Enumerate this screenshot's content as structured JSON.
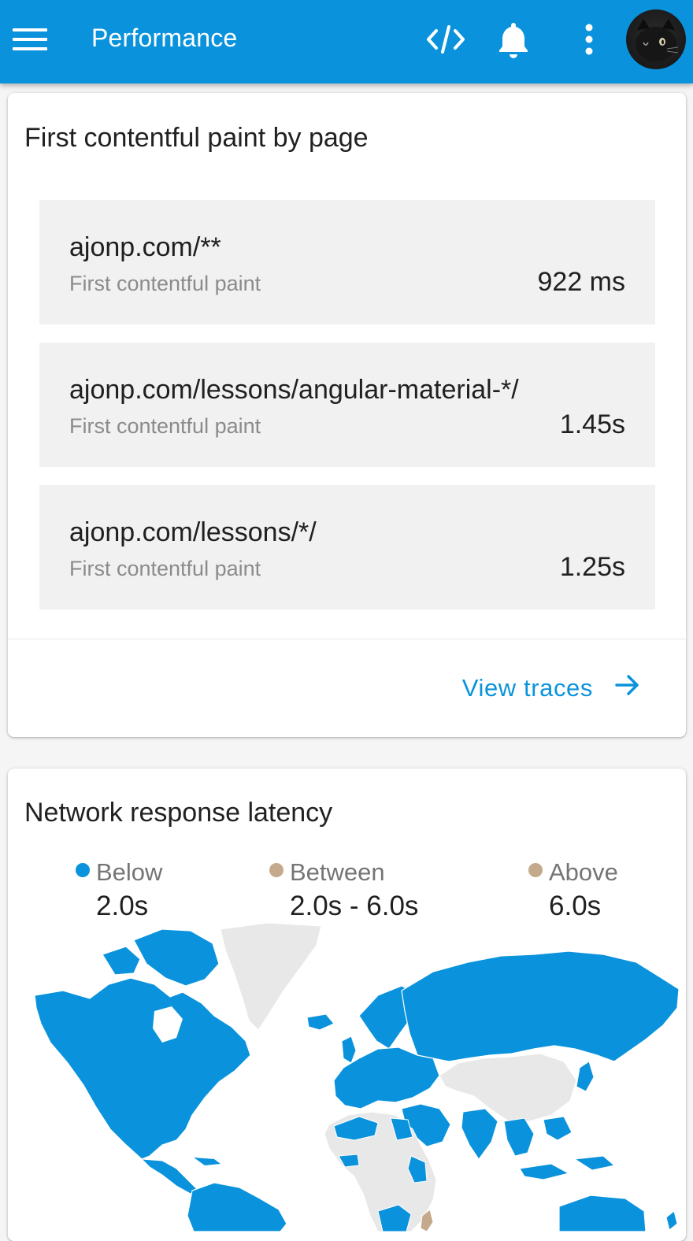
{
  "app_bar": {
    "title": "Performance",
    "icons": [
      "menu-icon",
      "code-icon",
      "bell-icon",
      "more-vert-icon",
      "avatar"
    ],
    "background": "#0a93dc"
  },
  "fcp_card": {
    "title": "First contentful paint by page",
    "rows": [
      {
        "url": "ajonp.com/**",
        "label": "First contentful paint",
        "value": "922 ms"
      },
      {
        "url": "ajonp.com/lessons/angular-material-*/",
        "label": "First contentful paint",
        "value": "1.45s"
      },
      {
        "url": "ajonp.com/lessons/*/",
        "label": "First contentful paint",
        "value": "1.25s"
      }
    ],
    "action_label": "View traces"
  },
  "latency_card": {
    "title": "Network response latency",
    "legend": [
      {
        "label": "Below",
        "value": "2.0s",
        "color": "#0a93dc"
      },
      {
        "label": "Between",
        "value": "2.0s - 6.0s",
        "color": "#c4a98c"
      },
      {
        "label": "Above",
        "value": "6.0s",
        "color": "#c4a98c"
      }
    ],
    "map_colors": {
      "fast": "#0a93dc",
      "no_data": "#e8e8e8",
      "between": "#c4a98c",
      "border": "#ffffff"
    }
  }
}
